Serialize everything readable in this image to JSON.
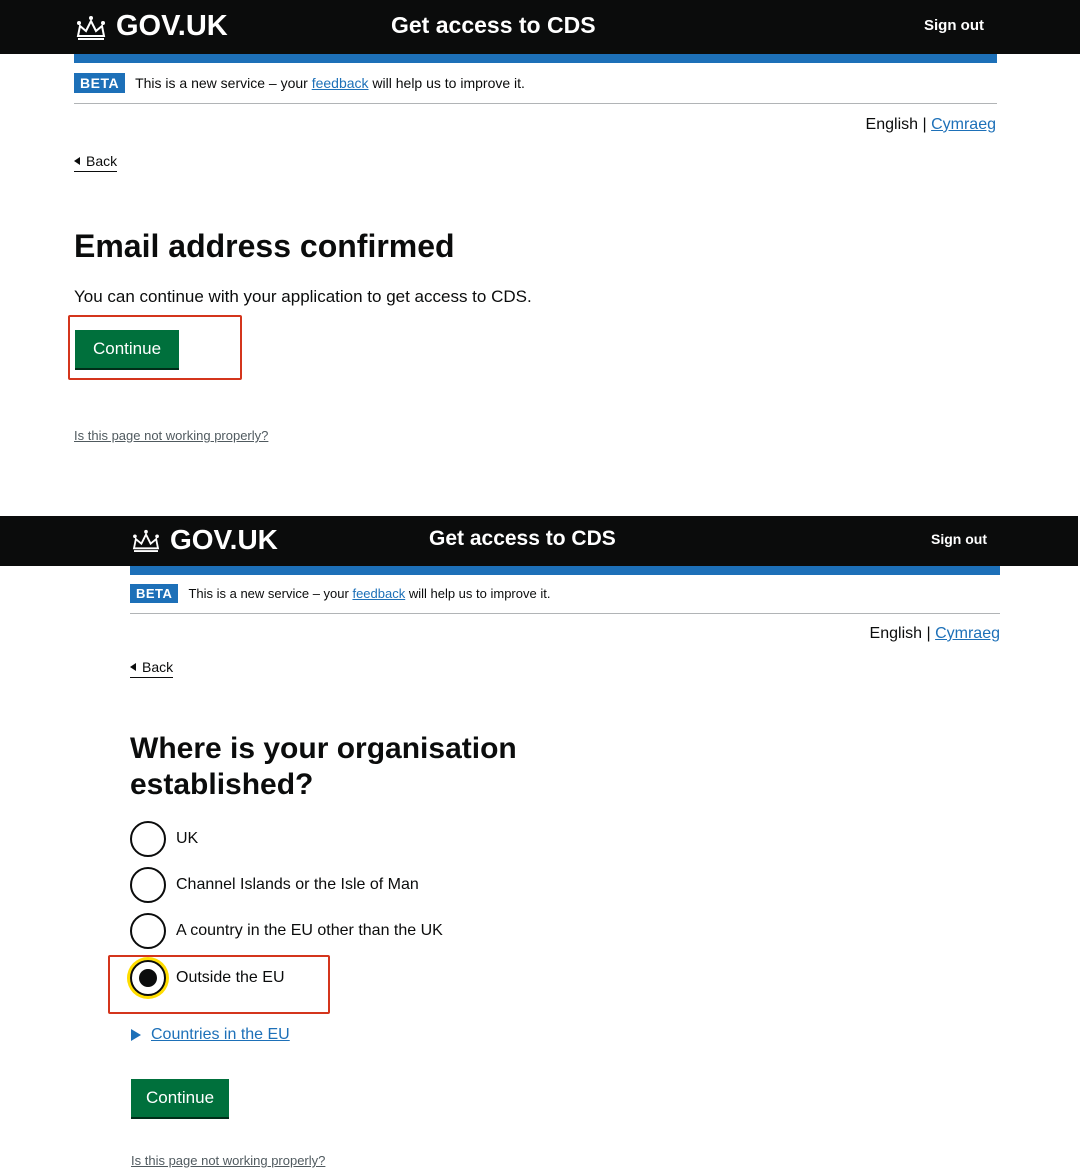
{
  "colors": {
    "header_bg": "#0b0c0c",
    "brand_blue": "#1d70b8",
    "button_green": "#00703c",
    "highlight_red": "#d4351c",
    "focus_yellow": "#ffdd00"
  },
  "screen1": {
    "header": {
      "logo_text": "GOV.UK",
      "logo_icon": "crown-icon",
      "service_name": "Get access to CDS",
      "sign_out": "Sign out"
    },
    "phase_banner": {
      "tag": "BETA",
      "text_before": "This is a new service – your ",
      "link": "feedback",
      "text_after": " will help us to improve it."
    },
    "language": {
      "english": "English",
      "separator": "|",
      "welsh": "Cymraeg"
    },
    "back": "Back",
    "title": "Email address confirmed",
    "body": "You can continue with your application to get access to CDS.",
    "continue_button": "Continue",
    "footer_link": "Is this page not working properly?"
  },
  "screen2": {
    "header": {
      "logo_text": "GOV.UK",
      "logo_icon": "crown-icon",
      "service_name": "Get access to CDS",
      "sign_out": "Sign out"
    },
    "phase_banner": {
      "tag": "BETA",
      "text_before": "This is a new service – your ",
      "link": "feedback",
      "text_after": " will help us to improve it."
    },
    "language": {
      "english": "English",
      "separator": "|",
      "welsh": "Cymraeg"
    },
    "back": "Back",
    "title": "Where is your organisation established?",
    "options": [
      {
        "label": "UK",
        "checked": false
      },
      {
        "label": "Channel Islands or the Isle of Man",
        "checked": false
      },
      {
        "label": "A country in the EU other than the UK",
        "checked": false
      },
      {
        "label": "Outside the EU",
        "checked": true
      }
    ],
    "details_summary": "Countries in the EU",
    "continue_button": "Continue",
    "footer_link": "Is this page not working properly?"
  }
}
